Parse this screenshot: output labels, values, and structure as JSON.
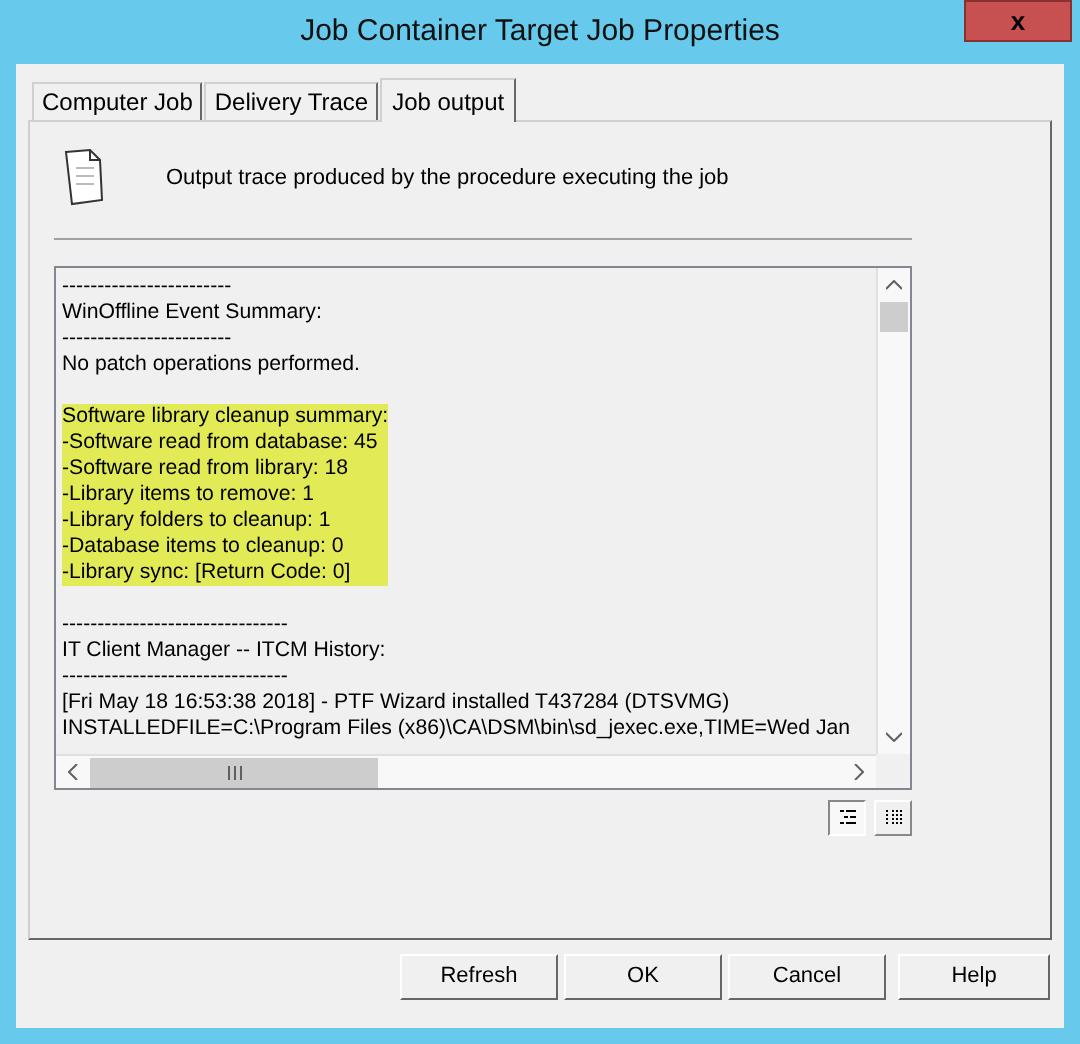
{
  "window": {
    "title": "Job Container Target Job Properties",
    "close": "x"
  },
  "tabs": [
    {
      "label": "Computer Job",
      "selected": false
    },
    {
      "label": "Delivery Trace",
      "selected": false
    },
    {
      "label": "Job output",
      "selected": true
    }
  ],
  "description": "Output trace produced by the procedure executing the job",
  "output_sections": [
    {
      "highlighted": false,
      "lines": [
        "------------------------",
        "WinOffline Event Summary:",
        "------------------------",
        "No patch operations performed."
      ]
    },
    {
      "highlighted": true,
      "lines": [
        "Software library cleanup summary:",
        "-Software read from database: 45",
        "-Software read from library: 18",
        "-Library items to remove: 1",
        "-Library folders to cleanup: 1",
        "-Database items to cleanup: 0",
        "-Library sync: [Return Code: 0]"
      ]
    },
    {
      "highlighted": false,
      "lines": [
        "--------------------------------",
        "IT Client Manager -- ITCM History:",
        "--------------------------------",
        "[Fri May 18 16:53:38 2018] - PTF Wizard installed T437284 (DTSVMG)",
        "INSTALLEDFILE=C:\\Program Files (x86)\\CA\\DSM\\bin\\sd_jexec.exe,TIME=Wed Jan"
      ]
    }
  ],
  "view_toggles": [
    {
      "selected": true
    },
    {
      "selected": false
    }
  ],
  "buttons": [
    "Refresh",
    "OK",
    "Cancel",
    "Help"
  ]
}
